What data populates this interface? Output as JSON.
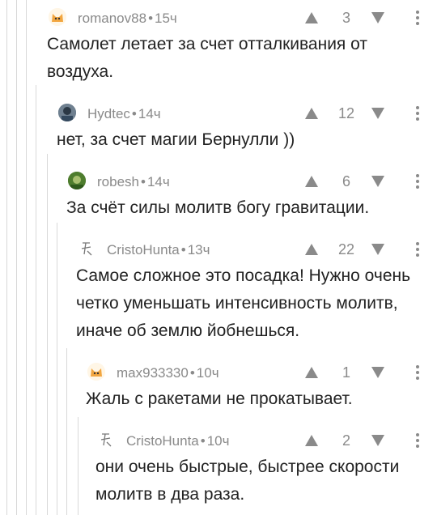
{
  "comments": [
    {
      "user": "romanov88",
      "time": "15ч",
      "score": "3",
      "text": "Самолет летает за счет отталкивания от воздуха.",
      "avatar": "cat-avatar"
    },
    {
      "user": "Hydtec",
      "time": "14ч",
      "score": "12",
      "text": "нет, за счет магии Бернулли ))",
      "avatar": "user-photo-avatar"
    },
    {
      "user": "robesh",
      "time": "14ч",
      "score": "6",
      "text": "За счёт силы молитв богу гравитации.",
      "avatar": "green-photo-avatar"
    },
    {
      "user": "CristoHunta",
      "time": "13ч",
      "score": "22",
      "text": "Самое сложное это посадка! Нужно очень четко уменьшать интенсивность молитв, иначе об землю йобнешься.",
      "avatar": "sketch-avatar"
    },
    {
      "user": "max933330",
      "time": "10ч",
      "score": "1",
      "text": "Жаль с ракетами не прокатывает.",
      "avatar": "cat-avatar"
    },
    {
      "user": "CristoHunta",
      "time": "10ч",
      "score": "2",
      "text": "они очень быстрые, быстрее скорости молитв в два раза.",
      "avatar": "sketch-avatar"
    }
  ],
  "colors": {
    "meta": "#8a8a8a",
    "text": "#222222",
    "thread_line": "#d8d8d8"
  }
}
